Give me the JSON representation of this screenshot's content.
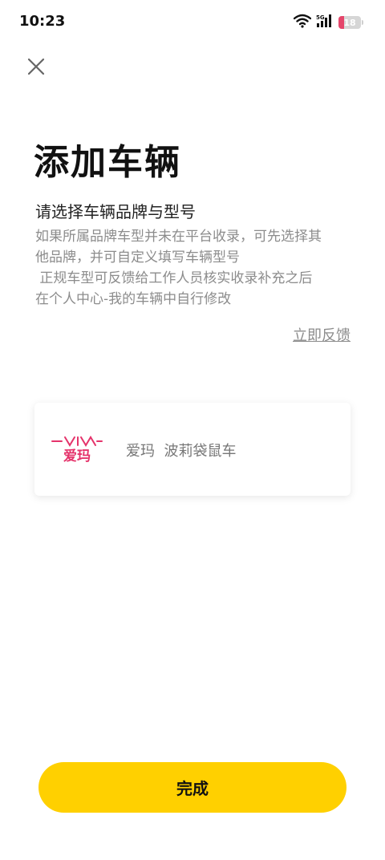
{
  "status_bar": {
    "time": "10:23",
    "network": "5G",
    "battery": "18"
  },
  "header": {
    "close_icon": "close-icon",
    "title": "添加车辆"
  },
  "intro": {
    "subtitle": "请选择车辆品牌与型号",
    "description_lines": [
      "如果所属品牌车型并未在平台收录，可先选择其",
      "他品牌，并可自定义填写车辆型号",
      " 正规车型可反馈给工作人员核实收录补充之后",
      "在个人中心-我的车辆中自行修改"
    ],
    "feedback_link": "立即反馈"
  },
  "vehicle": {
    "brand_logo_text": "AIMA",
    "brand_logo_cn": "爱玛",
    "name": "爱玛  波莉袋鼠车"
  },
  "actions": {
    "done_label": "完成"
  },
  "colors": {
    "accent": "#ffd000",
    "brand_red": "#e5336b",
    "muted_text": "#8c8c8c"
  }
}
